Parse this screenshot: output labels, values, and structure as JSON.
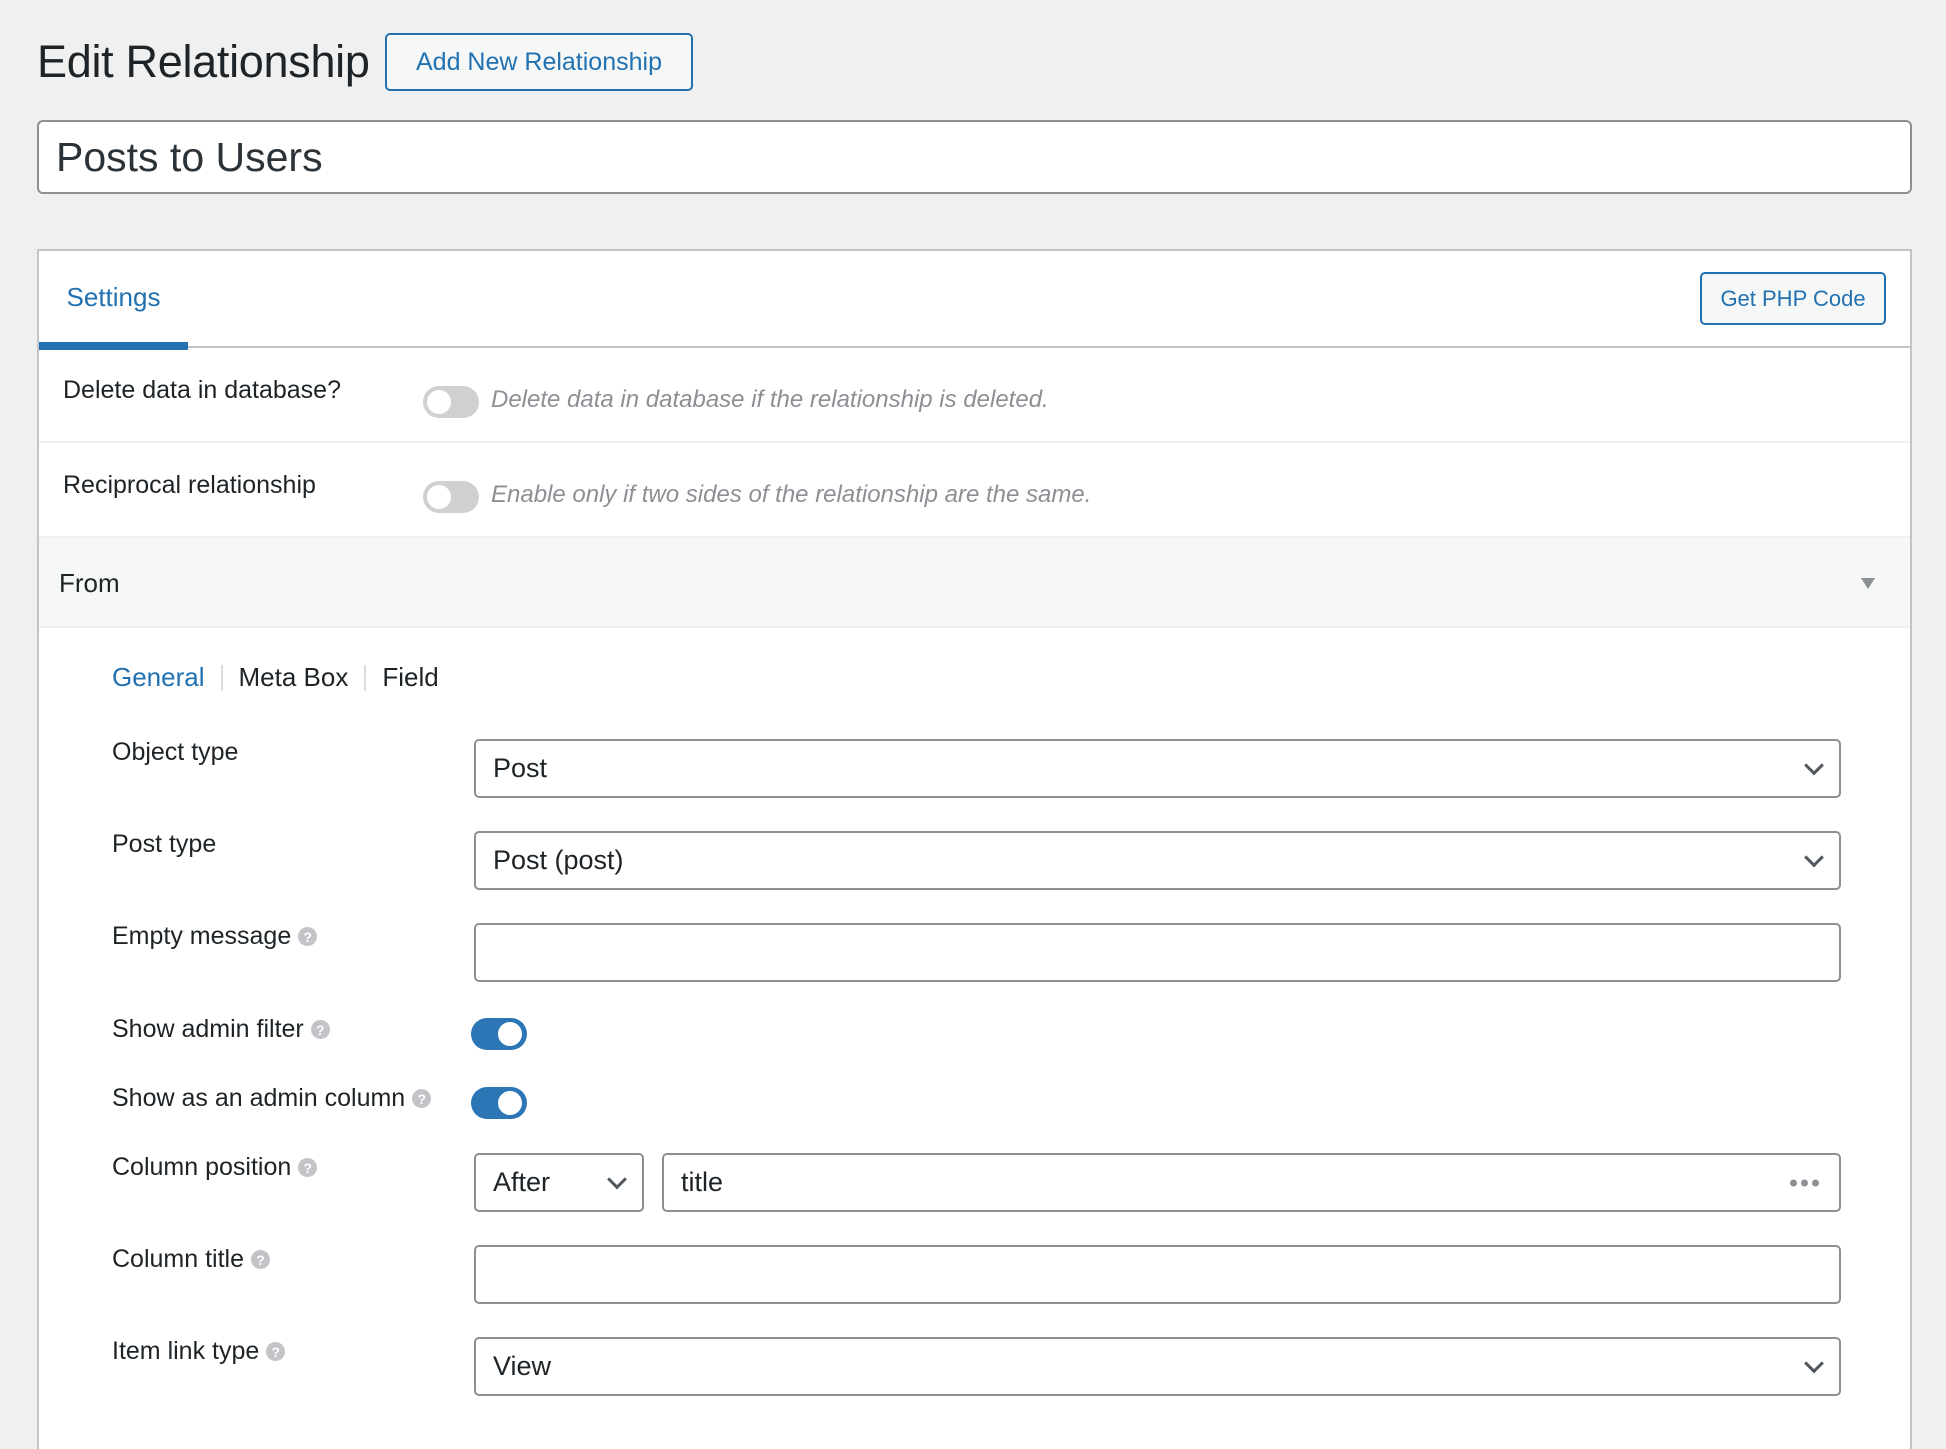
{
  "header": {
    "title": "Edit Relationship",
    "add_new_label": "Add New Relationship"
  },
  "title_input": {
    "value": "Posts to Users"
  },
  "tabs": {
    "settings_label": "Settings",
    "php_code_label": "Get PHP Code"
  },
  "settings": {
    "delete_data": {
      "label": "Delete data in database?",
      "enabled": false,
      "description": "Delete data in database if the relationship is deleted."
    },
    "reciprocal": {
      "label": "Reciprocal relationship",
      "enabled": false,
      "description": "Enable only if two sides of the relationship are the same."
    }
  },
  "from_section": {
    "label": "From",
    "subtabs": [
      "General",
      "Meta Box",
      "Field"
    ],
    "active_subtab": "General",
    "fields": {
      "object_type": {
        "label": "Object type",
        "value": "Post"
      },
      "post_type": {
        "label": "Post type",
        "value": "Post (post)"
      },
      "empty_message": {
        "label": "Empty message",
        "value": ""
      },
      "show_admin_filter": {
        "label": "Show admin filter",
        "enabled": true
      },
      "show_admin_column": {
        "label": "Show as an admin column",
        "enabled": true
      },
      "column_position": {
        "label": "Column position",
        "position": "After",
        "target": "title"
      },
      "column_title": {
        "label": "Column title",
        "value": ""
      },
      "item_link_type": {
        "label": "Item link type",
        "value": "View"
      }
    }
  },
  "colors": {
    "accent": "#2271b1",
    "toggle_on": "#2c76b6",
    "toggle_off": "#d0d0d0",
    "background": "#f0f0f1"
  }
}
